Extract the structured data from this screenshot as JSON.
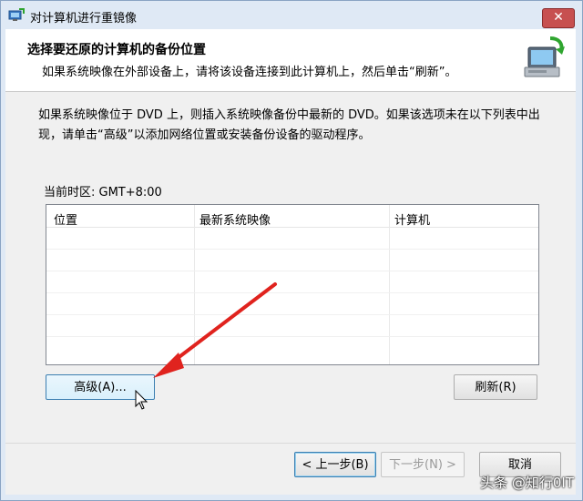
{
  "window": {
    "title": "对计算机进行重镜像",
    "close_glyph": "✕"
  },
  "header": {
    "title": "选择要还原的计算机的备份位置",
    "subtitle": "如果系统映像在外部设备上，请将该设备连接到此计算机上，然后单击“刷新”。",
    "icon": "backup-restore-computer-icon"
  },
  "main": {
    "description": "如果系统映像位于 DVD 上，则插入系统映像备份中最新的 DVD。如果该选项未在以下列表中出现，请单击“高级”以添加网络位置或安装备份设备的驱动程序。",
    "timezone": "当前时区: GMT+8:00",
    "list": {
      "columns": [
        "位置",
        "最新系统映像",
        "计算机"
      ],
      "rows": []
    },
    "advanced_label": "高级(A)...",
    "refresh_label": "刷新(R)"
  },
  "footer": {
    "back_label": "< 上一步(B)",
    "next_label": "下一步(N) >",
    "cancel_label": "取消"
  },
  "overlay": {
    "watermark": "头条 @知行0IT",
    "arrow_color": "#e0231e"
  }
}
